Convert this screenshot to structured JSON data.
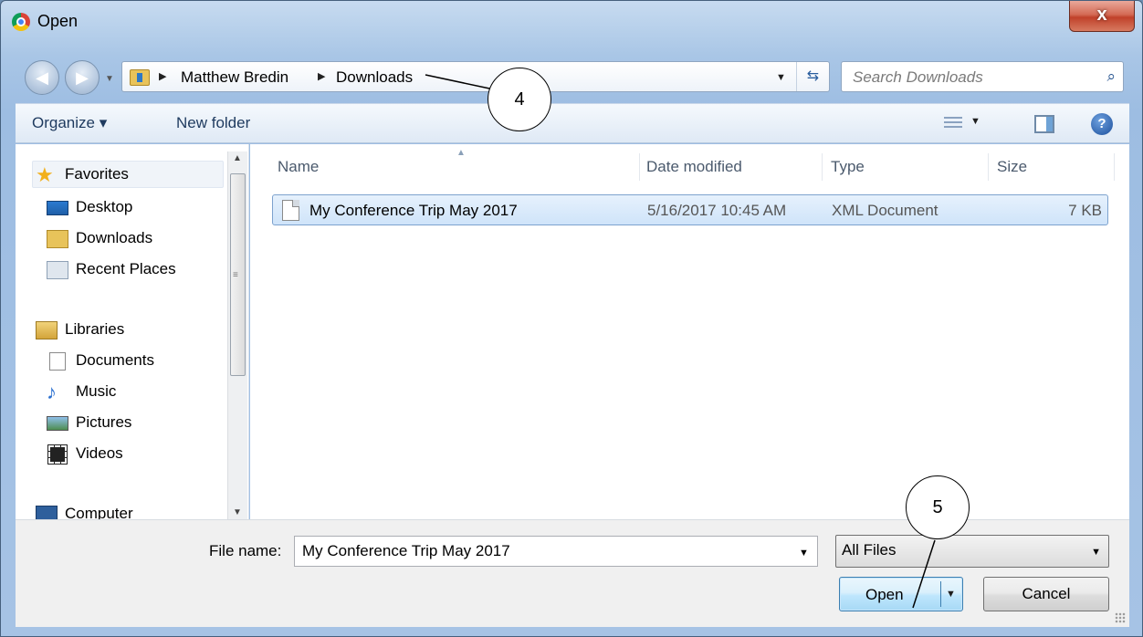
{
  "window": {
    "title": "Open",
    "close_label": "x"
  },
  "address": {
    "path": [
      "Matthew Bredin",
      "Downloads"
    ],
    "search_placeholder": "Search Downloads"
  },
  "toolbar": {
    "organize_label": "Organize ▾",
    "new_folder_label": "New folder"
  },
  "sidebar": {
    "favorites_header": "Favorites",
    "favorites": [
      "Desktop",
      "Downloads",
      "Recent Places"
    ],
    "libraries_header": "Libraries",
    "libraries": [
      "Documents",
      "Music",
      "Pictures",
      "Videos"
    ],
    "computer_header": "Computer"
  },
  "file_list": {
    "columns": [
      "Name",
      "Date modified",
      "Type",
      "Size"
    ],
    "rows": [
      {
        "name": "My Conference Trip May 2017",
        "date": "5/16/2017 10:45 AM",
        "type": "XML Document",
        "size": "7 KB"
      }
    ]
  },
  "footer": {
    "file_name_label": "File name:",
    "file_name_value": "My Conference Trip May 2017",
    "filter_value": "All Files",
    "open_label": "Open",
    "cancel_label": "Cancel"
  },
  "annotations": {
    "callout_4": "4",
    "callout_5": "5"
  }
}
